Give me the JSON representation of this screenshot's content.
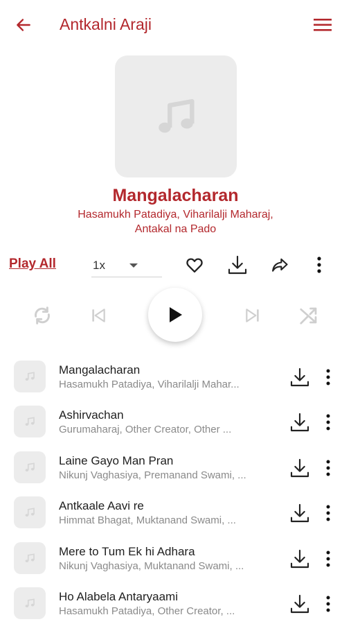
{
  "header": {
    "title": "Antkalni Araji",
    "back_icon": "arrow-left-icon",
    "menu_icon": "hamburger-menu-icon"
  },
  "album": {
    "title": "Mangalacharan",
    "artists": "Hasamukh Patadiya, Viharilalji Maharaj, Antakal na Pado",
    "art_icon": "music-note-icon"
  },
  "controls": {
    "play_all_label": "Play All",
    "speed_value": "1x"
  },
  "tracks": [
    {
      "title": "Mangalacharan",
      "artists": "Hasamukh Patadiya, Viharilalji Mahar..."
    },
    {
      "title": "Ashirvachan",
      "artists": "Gurumaharaj, Other Creator, Other ..."
    },
    {
      "title": "Laine Gayo Man Pran",
      "artists": "Nikunj Vaghasiya, Premanand Swami, ..."
    },
    {
      "title": "Antkaale Aavi re",
      "artists": "Himmat Bhagat, Muktanand Swami, ..."
    },
    {
      "title": "Mere to Tum Ek hi Adhara",
      "artists": "Nikunj Vaghasiya, Muktanand Swami, ..."
    },
    {
      "title": "Ho Alabela Antaryaami",
      "artists": "Hasamukh Patadiya, Other Creator, ..."
    }
  ],
  "colors": {
    "accent": "#b3282d",
    "placeholder_bg": "#ececec",
    "disabled_icon": "#cfcfcf"
  }
}
